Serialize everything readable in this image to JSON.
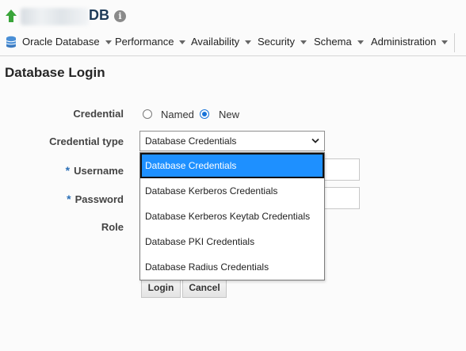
{
  "header": {
    "db_name": "DB",
    "info_glyph": "i"
  },
  "menubar": {
    "items": [
      {
        "label": "Oracle Database"
      },
      {
        "label": "Performance"
      },
      {
        "label": "Availability"
      },
      {
        "label": "Security"
      },
      {
        "label": "Schema"
      },
      {
        "label": "Administration"
      }
    ]
  },
  "page": {
    "title": "Database Login"
  },
  "form": {
    "credential_label": "Credential",
    "credential_options": {
      "named": "Named",
      "new": "New"
    },
    "credential_selected": "New",
    "credential_type_label": "Credential type",
    "credential_type_value": "Database Credentials",
    "username_label": "Username",
    "password_label": "Password",
    "role_label": "Role",
    "required_marker": "*",
    "dropdown_options": [
      "Database Credentials",
      "Database Kerberos Credentials",
      "Database Kerberos Keytab Credentials",
      "Database PKI Credentials",
      "Database Radius Credentials"
    ],
    "dropdown_selected_index": 0
  },
  "buttons": {
    "login": "Login",
    "cancel": "Cancel"
  },
  "colors": {
    "accent": "#1e90ff",
    "required": "#2b6fb6",
    "db_name": "#1f3b58",
    "up_arrow": "#3aa53a"
  },
  "icons": {
    "status": "up-arrow-icon",
    "info": "info-icon",
    "menu": "database-icon",
    "select": "chevron-down-icon"
  }
}
